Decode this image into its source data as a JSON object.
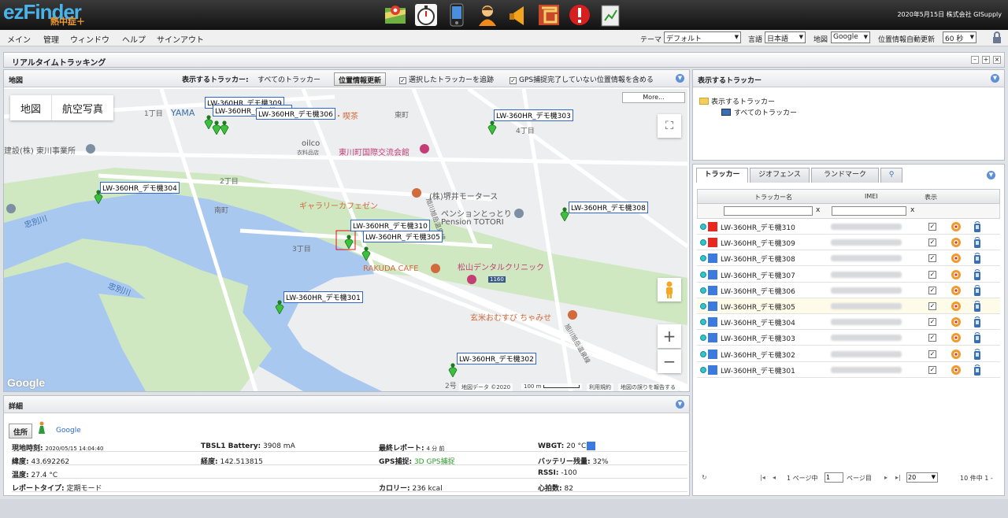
{
  "app": {
    "logo_text": "ezFinder",
    "logo_sub": "熱中症＋",
    "top_right": "2020年5月15日 株式会社 GISupply",
    "icons": [
      "map-icon",
      "stopwatch-icon",
      "phone-icon",
      "person-icon",
      "horn-icon",
      "maze-icon",
      "alert-icon",
      "clipboard-chart-icon"
    ]
  },
  "menu": {
    "items": [
      "メイン",
      "管理",
      "ウィンドウ",
      "ヘルプ",
      "サインアウト"
    ],
    "theme_label": "テーマ",
    "theme_value": "デフォルト",
    "language_label": "言語",
    "language_value": "日本語",
    "map_label": "地図",
    "map_value": "Google",
    "refresh_label": "位置情報自動更新",
    "refresh_value": "60 秒"
  },
  "window": {
    "title": "リアルタイムトラッキング"
  },
  "map_panel": {
    "title": "地図",
    "trackers_label": "表示するトラッカー:",
    "trackers_value": "すべてのトラッカー",
    "update_button": "位置情報更新",
    "follow_label": "選択したトラッカーを追跡",
    "include_label": "GPS捕捉完了していない位置情報を含める",
    "map_type_map": "地図",
    "map_type_aerial": "航空写真",
    "more_button": "More...",
    "footer_data": "地図データ ©2020",
    "footer_scale": "100 m",
    "footer_terms": "利用規約",
    "footer_report": "地図の誤りを報告する",
    "google": "Google",
    "labels": {
      "chome1": "1丁目",
      "yama": "YAMA",
      "cafe": "カフェ・喫茶",
      "higashimachi": "東町",
      "chome4": "4丁目",
      "oilco": "oilco",
      "oilco_sub": "衣料品店",
      "kouryu": "東川町国際交流会館",
      "construction": "建設(株) 東川事業所",
      "chome2": "2丁目",
      "minami": "南町",
      "gallery": "ギャラリーカフェゼン",
      "motors": "(株)堺井モータース",
      "pension": "ペンションとっとり",
      "pension_en": "Pension TOTORI",
      "chome3": "3丁目",
      "rakuda": "RAKUDA CAFE",
      "dental": "松山デンタルクリニック",
      "route": "1160",
      "river1": "忠別川",
      "river2": "忠別川",
      "genmai": "玄米おむすび ちゃみせ",
      "road1": "旭川旭岳温泉線",
      "road2": "旭川旭岳温泉線",
      "gou2": "2号"
    },
    "pins": [
      "LW-360HR_デモ機309",
      "LW-360HR_デモ機307",
      "LW-360HR_デモ機306",
      "LW-360HR_デモ機303",
      "LW-360HR_デモ機304",
      "LW-360HR_デモ機308",
      "LW-360HR_デモ機310",
      "LW-360HR_デモ機305",
      "LW-360HR_デモ機301",
      "LW-360HR_デモ機302"
    ]
  },
  "details": {
    "title": "詳細",
    "address_button": "住所",
    "google_link": "Google",
    "rows": [
      [
        {
          "label": "現地時刻:",
          "value": "2020/05/15 14:04:40"
        },
        {
          "label": "TBSL1 Battery:",
          "value": "3908 mA"
        },
        {
          "label": "最終レポート:",
          "value": "4 分 前"
        },
        {
          "label": "WBGT:",
          "value": "20 °C"
        }
      ],
      [
        {
          "label": "緯度:",
          "value": "43.692262"
        },
        {
          "label": "経度:",
          "value": "142.513815"
        },
        {
          "label": "GPS捕捉:",
          "value": "3D GPS捕捉"
        },
        {
          "label": "バッテリー残量:",
          "value": "32%"
        }
      ],
      [
        {
          "label": "温度:",
          "value": "27.4 °C"
        },
        {
          "label": "",
          "value": ""
        },
        {
          "label": "",
          "value": ""
        },
        {
          "label": "RSSI:",
          "value": "-100"
        }
      ],
      [
        {
          "label": "レポートタイプ:",
          "value": "定期モード"
        },
        {
          "label": "",
          "value": ""
        },
        {
          "label": "カロリー:",
          "value": "236 kcal"
        },
        {
          "label": "心拍数:",
          "value": "82"
        }
      ]
    ],
    "wbgt_color": "#3b7be0"
  },
  "tracker_panel": {
    "title": "表示するトラッカー",
    "tree_root": "表示するトラッカー",
    "tree_child": "すべてのトラッカー",
    "tabs": [
      "トラッカー",
      "ジオフェンス",
      "ランドマーク"
    ],
    "columns": {
      "name": "トラッカー名",
      "imei": "IMEI",
      "show": "表示"
    },
    "filter_clear": "x",
    "rows": [
      {
        "name": "LW-360HR_デモ機310",
        "color": "#e8271f",
        "shown": true
      },
      {
        "name": "LW-360HR_デモ機309",
        "color": "#e8271f",
        "shown": true
      },
      {
        "name": "LW-360HR_デモ機308",
        "color": "#3b7be0",
        "shown": true
      },
      {
        "name": "LW-360HR_デモ機307",
        "color": "#3b7be0",
        "shown": true
      },
      {
        "name": "LW-360HR_デモ機306",
        "color": "#3b7be0",
        "shown": true
      },
      {
        "name": "LW-360HR_デモ機305",
        "color": "#3b7be0",
        "shown": true
      },
      {
        "name": "LW-360HR_デモ機304",
        "color": "#3b7be0",
        "shown": true
      },
      {
        "name": "LW-360HR_デモ機303",
        "color": "#3b7be0",
        "shown": true
      },
      {
        "name": "LW-360HR_デモ機302",
        "color": "#3b7be0",
        "shown": true
      },
      {
        "name": "LW-360HR_デモ機301",
        "color": "#3b7be0",
        "shown": true
      }
    ],
    "pager": {
      "page_label": "1 ページ中",
      "page_value": "1",
      "page_suffix": "ページ目",
      "per_page": "20",
      "count": "10 件中 1 -"
    }
  }
}
